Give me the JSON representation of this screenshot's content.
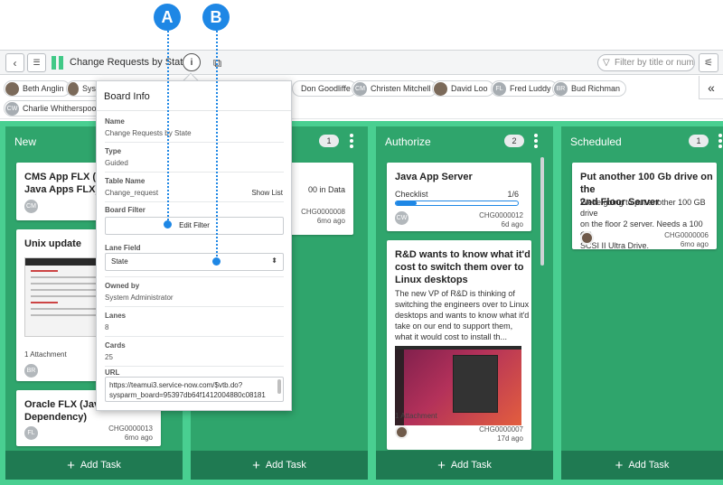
{
  "callouts": {
    "a": "A",
    "b": "B"
  },
  "header": {
    "title": "Change Requests by State",
    "filter_placeholder": "Filter by title or number"
  },
  "icons": {
    "back": "‹",
    "list": "☰",
    "info": "i",
    "filter": "▽",
    "settings": "⚟",
    "collapse": "«",
    "share": "⧉"
  },
  "members": [
    {
      "initials": "",
      "name": "Beth Anglin"
    },
    {
      "initials": "",
      "name": "Sys"
    },
    {
      "initials": "",
      "name": "Don Goodliffe"
    },
    {
      "initials": "CM",
      "name": "Christen Mitchell"
    },
    {
      "initials": "",
      "name": "David Loo"
    },
    {
      "initials": "FL",
      "name": "Fred Luddy"
    },
    {
      "initials": "BR",
      "name": "Bud Richman"
    },
    {
      "initials": "CW",
      "name": "Charlie Whitherspoon"
    }
  ],
  "lanes": [
    {
      "name": "New",
      "count": "",
      "cards": [
        {
          "title_1": "CMS App FLX (dep",
          "title_2": "Java Apps FLX)",
          "avatar": "CM"
        },
        {
          "title": "Unix update",
          "attachment": "1 Attachment",
          "avatar": "BR"
        },
        {
          "title_1": "Oracle FLX (Java",
          "title_2": "Dependency)",
          "number": "CHG0000013",
          "age": "6mo ago",
          "avatar": "FL"
        }
      ],
      "add": "Add Task"
    },
    {
      "name": "",
      "count": "1",
      "cards": [
        {
          "text": "00 in Data",
          "number": "CHG0000008",
          "age": "6mo ago"
        }
      ],
      "add": "Add Task"
    },
    {
      "name": "Authorize",
      "count": "2",
      "cards": [
        {
          "title": "Java App Server",
          "checklist_label": "Checklist",
          "checklist_count": "1/6",
          "checklist_progress": 0.1667,
          "number": "CHG0000012",
          "age": "6d ago",
          "avatar": "CW"
        },
        {
          "title_1": "R&D wants to know what it'd",
          "title_2": "cost to switch them over to",
          "title_3": "Linux desktops",
          "desc_1": "The new VP of R&D is thinking of",
          "desc_2": "switching the engineers over to Linux",
          "desc_3": "desktops and wants to know what it'd",
          "desc_4": "take on our end to support them,",
          "desc_5": "what it would cost to install th...",
          "attachment": "1 Attachment",
          "number": "CHG0000007",
          "age": "17d ago"
        }
      ],
      "add": "Add Task"
    },
    {
      "name": "Scheduled",
      "count": "1",
      "cards": [
        {
          "title_1": "Put another 100 Gb drive on the",
          "title_2": "2nd Floor Server",
          "desc_1": "We're going to put another 100 GB drive",
          "desc_2": "on the floor 2 server. Needs a 100 GB",
          "desc_3": "SCSI II Ultra Drive.",
          "number": "CHG0000006",
          "age": "6mo ago"
        }
      ],
      "add": "Add Task"
    }
  ],
  "board_info": {
    "title": "Board Info",
    "name_label": "Name",
    "name_value": "Change Requests by State",
    "type_label": "Type",
    "type_value": "Guided",
    "table_label": "Table Name",
    "table_value": "Change_request",
    "show_list": "Show List",
    "filter_label": "Board Filter",
    "edit_filter": "Edit Filter",
    "lane_label": "Lane Field",
    "lane_value": "State",
    "owned_label": "Owned by",
    "owned_value": "System Administrator",
    "lanes_label": "Lanes",
    "lanes_value": "8",
    "cards_label": "Cards",
    "cards_value": "25",
    "url_label": "URL",
    "url_line_1": "https://teamui3.service-now.com/$vtb.do?",
    "url_line_2": "sysparm_board=95397db64f1412004880c08181"
  },
  "colors": {
    "accent": "#1e87e5",
    "lane": "#2fa56c",
    "board": "#49cf91",
    "add_task": "#1f7a52"
  }
}
